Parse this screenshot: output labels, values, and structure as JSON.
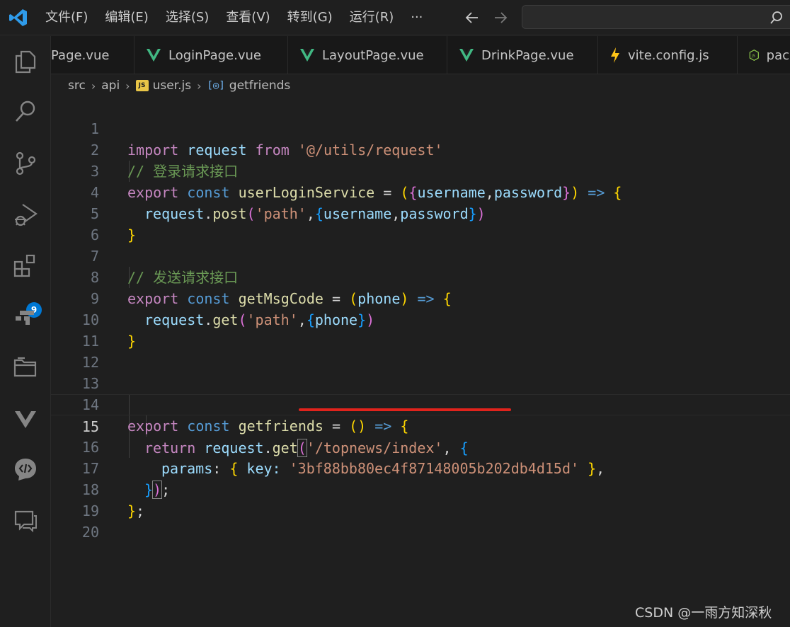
{
  "menu": [
    "文件(F)",
    "编辑(E)",
    "选择(S)",
    "查看(V)",
    "转到(G)",
    "运行(R)",
    "···"
  ],
  "tabs": [
    {
      "label": "Page.vue",
      "icon": "none"
    },
    {
      "label": "LoginPage.vue",
      "icon": "vue-icon"
    },
    {
      "label": "LayoutPage.vue",
      "icon": "vue-icon"
    },
    {
      "label": "DrinkPage.vue",
      "icon": "vue-icon"
    },
    {
      "label": "vite.config.js",
      "icon": "vite-icon"
    },
    {
      "label": "pac",
      "icon": "node-icon"
    }
  ],
  "breadcrumb": {
    "p1": "src",
    "p2": "api",
    "file_badge": "JS",
    "file": "user.js",
    "symbol": "getfriends"
  },
  "activity_badge": "9",
  "editor": {
    "line_numbers": [
      "1",
      "2",
      "3",
      "4",
      "5",
      "6",
      "7",
      "8",
      "9",
      "10",
      "11",
      "12",
      "13",
      "14",
      "15",
      "16",
      "17",
      "18",
      "19",
      "20"
    ],
    "active_line": "15",
    "tokens": {
      "l1": [
        "import",
        " request ",
        "from",
        " ",
        "'@/utils/request'"
      ],
      "l2": [
        "// 登录请求接口"
      ],
      "l3": [
        "export",
        " ",
        "const",
        " ",
        "userLoginService",
        " = ",
        "(",
        "{",
        "username",
        ",",
        "password",
        "}",
        ")",
        " => ",
        "{"
      ],
      "l4": [
        "request",
        ".",
        "post",
        "(",
        "'path'",
        ",",
        "{",
        "username",
        ",",
        "password",
        "}",
        ")"
      ],
      "l5": [
        "}"
      ],
      "l7": [
        "// 发送请求接口"
      ],
      "l8": [
        "export",
        " ",
        "const",
        " ",
        "getMsgCode",
        " = ",
        "(",
        "phone",
        ")",
        " => ",
        "{"
      ],
      "l9": [
        "request",
        ".",
        "get",
        "(",
        "'path'",
        ",",
        "{",
        "phone",
        "}",
        ")"
      ],
      "l10": [
        "}"
      ],
      "l14": [
        "export",
        " ",
        "const",
        " ",
        "getfriends",
        " = ",
        "()",
        " => ",
        "{"
      ],
      "l15": [
        "return",
        " ",
        "request",
        ".",
        "get",
        "(",
        "'/topnews/index'",
        ", ",
        "{"
      ],
      "l16": [
        "params",
        ": ",
        "{",
        " key: ",
        "'3bf88bb80ec4f87148005b202db4d15d'",
        " ",
        "}",
        ","
      ],
      "l17": [
        "}",
        ")",
        ";"
      ],
      "l18": [
        "}",
        ";"
      ]
    }
  },
  "watermark": "CSDN @一雨方知深秋",
  "colors": {
    "accent": "#0078d4",
    "underline": "#e0231c",
    "vue": "#41b883",
    "vite": "#ffc517",
    "node": "#8cc84b"
  }
}
